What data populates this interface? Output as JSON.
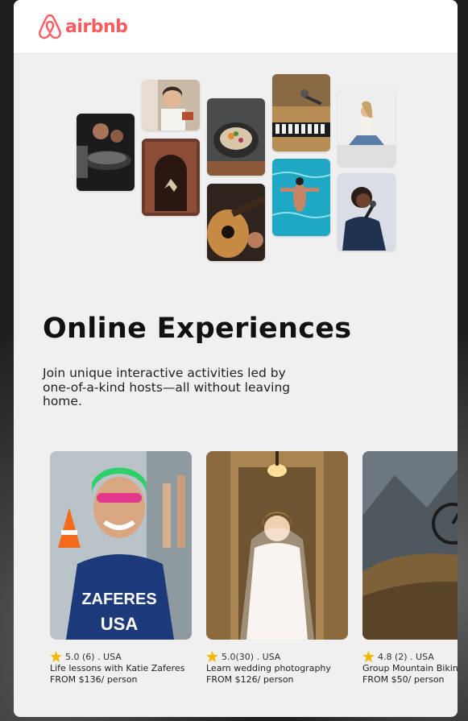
{
  "brand": {
    "name": "airbnb",
    "color": "#ff5a5f"
  },
  "hero": {
    "title": "Online Experiences",
    "subtitle": "Join unique interactive activities led by one-of-a-kind hosts—all without leaving home."
  },
  "collage_tiles": [
    "cooking-photo",
    "host-smiling-photo",
    "dancer-doorway-photo",
    "food-bowl-photo",
    "guitar-photo",
    "microphone-keyboard-photo",
    "swimmer-pool-photo",
    "yoga-meditation-photo",
    "singer-photo"
  ],
  "experiences": [
    {
      "rating": "5.0 (6) . USA",
      "title": "Life lessons with Katie Zaferes",
      "price": "FROM $136/ person",
      "image": "athlete-photo"
    },
    {
      "rating": "5.0(30) . USA",
      "title": "Learn wedding photography",
      "price": "FROM $126/ person",
      "image": "bride-photo"
    },
    {
      "rating": "4.8 (2) . USA",
      "title": "Group Mountain Biking",
      "price": "FROM $50/ person",
      "image": "mountain-bike-photo"
    }
  ],
  "colors": {
    "star": "#f5b800",
    "panel": "#f0f0f0"
  }
}
